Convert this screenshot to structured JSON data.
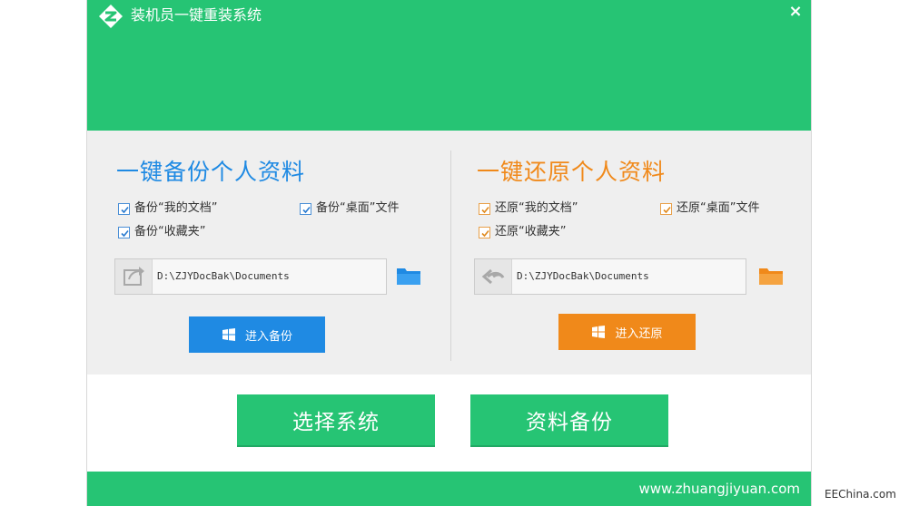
{
  "window": {
    "title": "装机员一键重装系统",
    "close_symbol": "×"
  },
  "backup": {
    "title": "一键备份个人资料",
    "checkboxes": [
      {
        "label": "备份“我的文档”",
        "checked": true
      },
      {
        "label": "备份“桌面”文件",
        "checked": true
      },
      {
        "label": "备份“收藏夹”",
        "checked": true
      }
    ],
    "path": "D:\\ZJYDocBak\\Documents",
    "button_label": "进入备份",
    "accent": "#1f8ae3"
  },
  "restore": {
    "title": "一键还原个人资料",
    "checkboxes": [
      {
        "label": "还原“我的文档”",
        "checked": true
      },
      {
        "label": "还原“桌面”文件",
        "checked": true
      },
      {
        "label": "还原“收藏夹”",
        "checked": true
      }
    ],
    "path": "D:\\ZJYDocBak\\Documents",
    "button_label": "进入还原",
    "accent": "#f0891a"
  },
  "main_buttons": {
    "select_system": "选择系统",
    "data_backup": "资料备份"
  },
  "footer": {
    "site": "www.zhuangjiyuan.com"
  },
  "watermark": "EEChina.com",
  "icons": {
    "logo": "zhuangjiyuan-logo-icon",
    "backup_path": "share-arrow-icon",
    "restore_path": "double-left-arrow-icon",
    "folder": "folder-icon",
    "windows": "windows-logo-icon",
    "check": "checkmark-icon"
  },
  "colors": {
    "brand_green": "#26c474",
    "panel_gray": "#efefef",
    "folder_blue": "#1f8ae3",
    "folder_orange": "#f0891a"
  }
}
